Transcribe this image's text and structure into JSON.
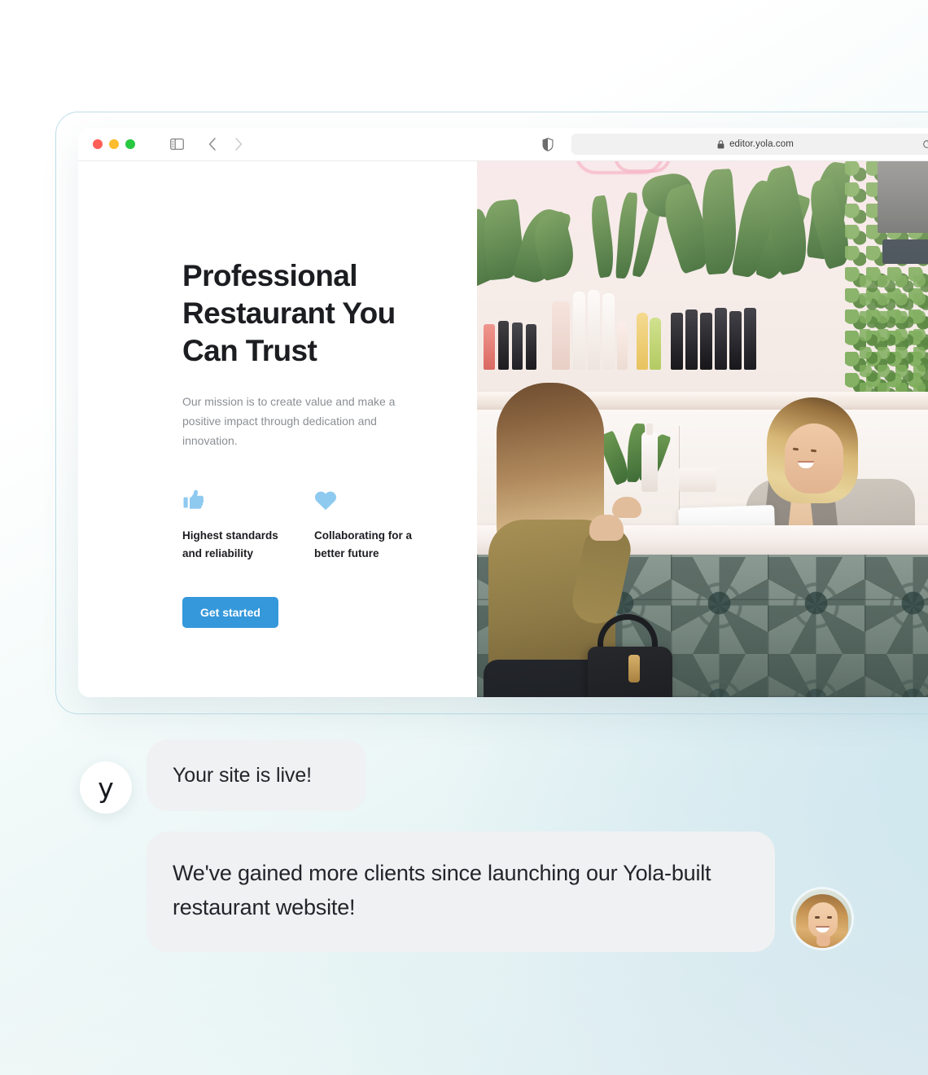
{
  "browser": {
    "url": "editor.yola.com",
    "icons": {
      "sidebar": "sidebar-toggle-icon",
      "back": "chevron-left-icon",
      "forward": "chevron-right-icon",
      "shield": "shield-privacy-icon",
      "lock": "lock-icon",
      "reload": "reload-icon"
    },
    "traffic_lights": {
      "close": "#ff5f57",
      "minimize": "#febc2e",
      "maximize": "#28c840"
    }
  },
  "site": {
    "hero": {
      "title": "Professional Restaurant You Can Trust",
      "subtitle": "Our mission is to create value and make a positive impact through dedication and innovation.",
      "cta_label": "Get started",
      "cta_color": "#3498db",
      "features": [
        {
          "icon": "thumbs-up-icon",
          "label": "Highest standards and reliability",
          "color": "#8ecaf0"
        },
        {
          "icon": "heart-icon",
          "label": "Collaborating for a better future",
          "color": "#8ecaf0"
        }
      ]
    },
    "photo_alt": "Two women at a salon reception counter with plants and a POS terminal"
  },
  "chat": {
    "brand_mark": "y",
    "messages": [
      {
        "from": "yola",
        "text": "Your site is live!"
      },
      {
        "from": "user",
        "text": "We've gained more clients since launching our Yola-built restaurant website!"
      }
    ]
  },
  "theme": {
    "accent": "#3498db",
    "icon_blue": "#8ecaf0",
    "bubble_bg": "#f0f1f2",
    "text_dark": "#1c1d21",
    "text_muted": "#8b8f94",
    "frame_border": "#bfdfe9"
  }
}
